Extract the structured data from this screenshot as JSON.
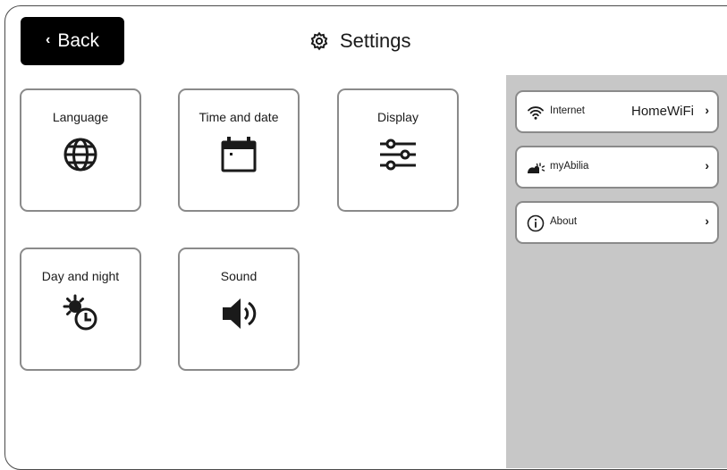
{
  "header": {
    "back_label": "Back",
    "back_chevron": "‹",
    "title": "Settings",
    "title_icon": "gear-icon"
  },
  "tiles": [
    {
      "label": "Language",
      "icon": "globe-icon"
    },
    {
      "label": "Time and date",
      "icon": "calendar-icon"
    },
    {
      "label": "Display",
      "icon": "sliders-icon"
    },
    {
      "label": "Day and night",
      "icon": "sun-clock-icon"
    },
    {
      "label": "Sound",
      "icon": "speaker-icon"
    }
  ],
  "side_panel": {
    "rows": [
      {
        "label": "Internet",
        "value": "HomeWiFi",
        "chevron": "›",
        "icon": "wifi-icon"
      },
      {
        "label": "myAbilia",
        "value": "",
        "chevron": "›",
        "icon": "myabilia-icon"
      },
      {
        "label": "About",
        "value": "",
        "chevron": "›",
        "icon": "info-icon"
      }
    ]
  },
  "colors": {
    "back_button_bg": "#000000",
    "tile_border": "#8a8a8a",
    "side_panel_bg": "#c7c7c7"
  }
}
